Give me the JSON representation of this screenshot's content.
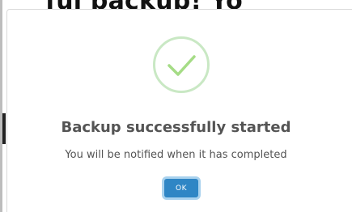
{
  "background": {
    "heading_fragment": "ful backup! Yo"
  },
  "dialog": {
    "icon": "success-check-icon",
    "title": "Backup successfully started",
    "message": "You will be notified when it has completed",
    "confirm_label": "OK",
    "colors": {
      "check": "#a5dc86",
      "check_ring": "#c9e8c4",
      "button": "#2f86c5",
      "text": "#545454"
    }
  }
}
